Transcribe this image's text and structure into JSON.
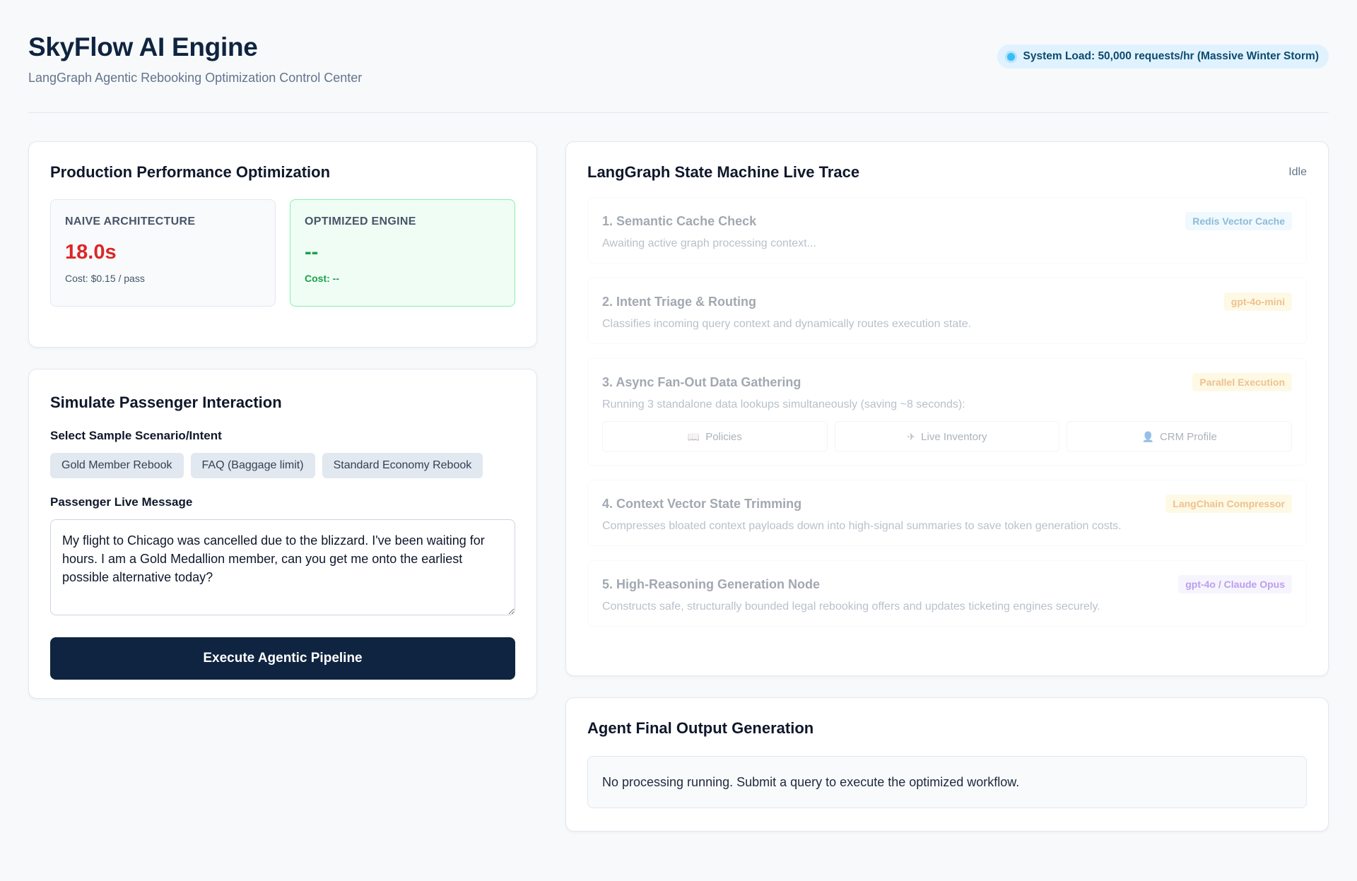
{
  "header": {
    "title": "SkyFlow AI Engine",
    "subtitle": "LangGraph Agentic Rebooking Optimization Control Center",
    "system_load": "System Load: 50,000 requests/hr (Massive Winter Storm)"
  },
  "performance": {
    "title": "Production Performance Optimization",
    "naive": {
      "label": "NAIVE ARCHITECTURE",
      "value": "18.0s",
      "cost": "Cost: $0.15 / pass"
    },
    "optimized": {
      "label": "OPTIMIZED ENGINE",
      "value": "--",
      "cost": "Cost: --"
    }
  },
  "simulate": {
    "title": "Simulate Passenger Interaction",
    "scenario_label": "Select Sample Scenario/Intent",
    "scenarios": [
      "Gold Member Rebook",
      "FAQ (Baggage limit)",
      "Standard Economy Rebook"
    ],
    "message_label": "Passenger Live Message",
    "message": "My flight to Chicago was cancelled due to the blizzard. I've been waiting for hours. I am a Gold Medallion member, can you get me onto the earliest possible alternative today?",
    "execute_label": "Execute Agentic Pipeline"
  },
  "trace": {
    "title": "LangGraph State Machine Live Trace",
    "status": "Idle",
    "steps": [
      {
        "title": "1. Semantic Cache Check",
        "badge": "Redis Vector Cache",
        "desc": "Awaiting active graph processing context..."
      },
      {
        "title": "2. Intent Triage & Routing",
        "badge": "gpt-4o-mini",
        "desc": "Classifies incoming query context and dynamically routes execution state."
      },
      {
        "title": "3. Async Fan-Out Data Gathering",
        "badge": "Parallel Execution",
        "desc": "Running 3 standalone data lookups simultaneously (saving ~8 seconds):",
        "subtasks": [
          {
            "icon": "book-icon",
            "label": "Policies"
          },
          {
            "icon": "airplane-icon",
            "label": "Live Inventory"
          },
          {
            "icon": "user-icon",
            "label": "CRM Profile"
          }
        ]
      },
      {
        "title": "4. Context Vector State Trimming",
        "badge": "LangChain Compressor",
        "desc": "Compresses bloated context payloads down into high-signal summaries to save token generation costs."
      },
      {
        "title": "5. High-Reasoning Generation Node",
        "badge": "gpt-4o / Claude Opus",
        "desc": "Constructs safe, structurally bounded legal rebooking offers and updates ticketing engines securely."
      }
    ]
  },
  "output": {
    "title": "Agent Final Output Generation",
    "text": "No processing running. Submit a query to execute the optimized workflow."
  }
}
